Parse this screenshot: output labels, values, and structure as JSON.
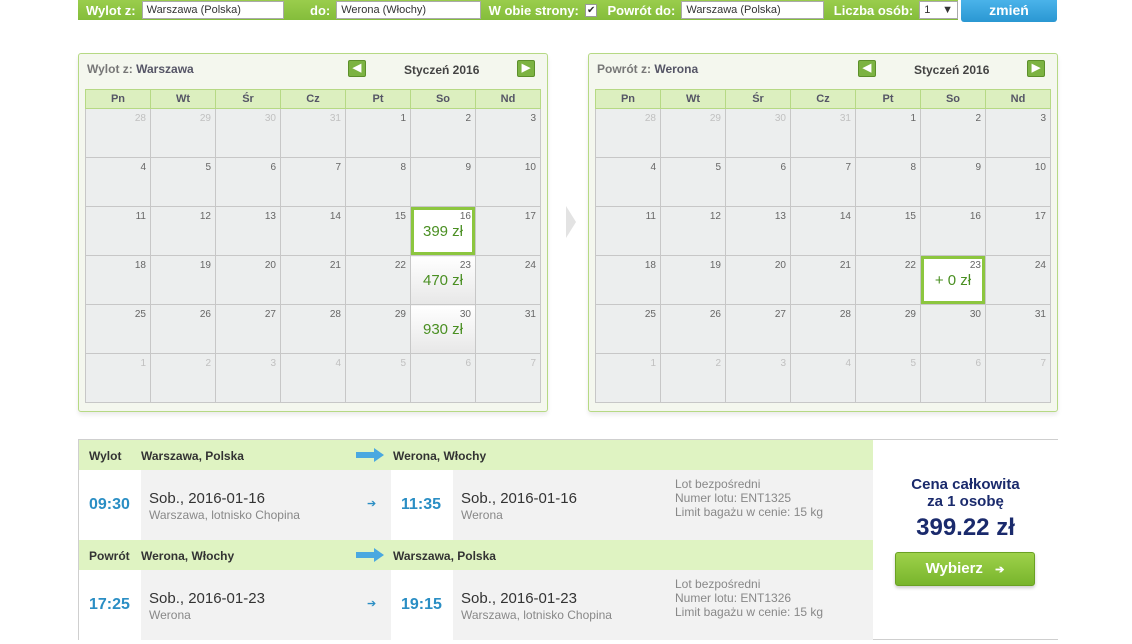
{
  "search": {
    "from_label": "Wylot z:",
    "from_value": "Warszawa (Polska)",
    "to_label": "do:",
    "to_value": "Werona (Włochy)",
    "roundtrip_label": "W obie strony:",
    "roundtrip_checked": "✔",
    "return_label": "Powrót do:",
    "return_value": "Warszawa (Polska)",
    "persons_label": "Liczba osób:",
    "persons_value": "1",
    "submit_label": "zmień"
  },
  "weekdays": [
    "Pn",
    "Wt",
    "Śr",
    "Cz",
    "Pt",
    "So",
    "Nd"
  ],
  "outbound_calendar": {
    "title_prefix": "Wylot z:",
    "title_city": "Warszawa",
    "month": "Styczeń 2016",
    "weeks": [
      [
        {
          "d": "28",
          "o": true
        },
        {
          "d": "29",
          "o": true
        },
        {
          "d": "30",
          "o": true
        },
        {
          "d": "31",
          "o": true
        },
        {
          "d": "1"
        },
        {
          "d": "2"
        },
        {
          "d": "3"
        }
      ],
      [
        {
          "d": "4"
        },
        {
          "d": "5"
        },
        {
          "d": "6"
        },
        {
          "d": "7"
        },
        {
          "d": "8"
        },
        {
          "d": "9"
        },
        {
          "d": "10"
        }
      ],
      [
        {
          "d": "11"
        },
        {
          "d": "12"
        },
        {
          "d": "13"
        },
        {
          "d": "14"
        },
        {
          "d": "15"
        },
        {
          "d": "16",
          "price": "399 zł",
          "selected": true
        },
        {
          "d": "17"
        }
      ],
      [
        {
          "d": "18"
        },
        {
          "d": "19"
        },
        {
          "d": "20"
        },
        {
          "d": "21"
        },
        {
          "d": "22"
        },
        {
          "d": "23",
          "price": "470 zł"
        },
        {
          "d": "24"
        }
      ],
      [
        {
          "d": "25"
        },
        {
          "d": "26"
        },
        {
          "d": "27"
        },
        {
          "d": "28"
        },
        {
          "d": "29"
        },
        {
          "d": "30",
          "price": "930 zł"
        },
        {
          "d": "31"
        }
      ],
      [
        {
          "d": "1",
          "o": true
        },
        {
          "d": "2",
          "o": true
        },
        {
          "d": "3",
          "o": true
        },
        {
          "d": "4",
          "o": true
        },
        {
          "d": "5",
          "o": true
        },
        {
          "d": "6",
          "o": true
        },
        {
          "d": "7",
          "o": true
        }
      ]
    ]
  },
  "return_calendar": {
    "title_prefix": "Powrót z:",
    "title_city": "Werona",
    "month": "Styczeń 2016",
    "weeks": [
      [
        {
          "d": "28",
          "o": true
        },
        {
          "d": "29",
          "o": true
        },
        {
          "d": "30",
          "o": true
        },
        {
          "d": "31",
          "o": true
        },
        {
          "d": "1"
        },
        {
          "d": "2"
        },
        {
          "d": "3"
        }
      ],
      [
        {
          "d": "4"
        },
        {
          "d": "5"
        },
        {
          "d": "6"
        },
        {
          "d": "7"
        },
        {
          "d": "8"
        },
        {
          "d": "9"
        },
        {
          "d": "10"
        }
      ],
      [
        {
          "d": "11"
        },
        {
          "d": "12"
        },
        {
          "d": "13"
        },
        {
          "d": "14"
        },
        {
          "d": "15"
        },
        {
          "d": "16"
        },
        {
          "d": "17"
        }
      ],
      [
        {
          "d": "18"
        },
        {
          "d": "19"
        },
        {
          "d": "20"
        },
        {
          "d": "21"
        },
        {
          "d": "22"
        },
        {
          "d": "23",
          "price": "+ 0 zł",
          "selected": true
        },
        {
          "d": "24"
        }
      ],
      [
        {
          "d": "25"
        },
        {
          "d": "26"
        },
        {
          "d": "27"
        },
        {
          "d": "28"
        },
        {
          "d": "29"
        },
        {
          "d": "30"
        },
        {
          "d": "31"
        }
      ],
      [
        {
          "d": "1",
          "o": true
        },
        {
          "d": "2",
          "o": true
        },
        {
          "d": "3",
          "o": true
        },
        {
          "d": "4",
          "o": true
        },
        {
          "d": "5",
          "o": true
        },
        {
          "d": "6",
          "o": true
        },
        {
          "d": "7",
          "o": true
        }
      ]
    ]
  },
  "outbound": {
    "label": "Wylot",
    "from": "Warszawa, Polska",
    "to": "Werona, Włochy",
    "dep_time": "09:30",
    "dep_date": "Sob., 2016-01-16",
    "dep_place": "Warszawa, lotnisko Chopina",
    "arr_time": "11:35",
    "arr_date": "Sob., 2016-01-16",
    "arr_place": "Werona",
    "info1": "Lot bezpośredni",
    "info2": "Numer lotu: ENT1325",
    "info3": "Limit bagażu w cenie: 15 kg"
  },
  "return": {
    "label": "Powrót",
    "from": "Werona, Włochy",
    "to": "Warszawa, Polska",
    "dep_time": "17:25",
    "dep_date": "Sob., 2016-01-23",
    "dep_place": "Werona",
    "arr_time": "19:15",
    "arr_date": "Sob., 2016-01-23",
    "arr_place": "Warszawa, lotnisko Chopina",
    "info1": "Lot bezpośredni",
    "info2": "Numer lotu: ENT1326",
    "info3": "Limit bagażu w cenie: 15 kg"
  },
  "price": {
    "title_line1": "Cena całkowita",
    "title_line2": "za 1 osobę",
    "amount": "399.22 zł",
    "button": "Wybierz"
  },
  "colors": {
    "accent_green": "#8cc63f",
    "accent_blue": "#2a8ec4",
    "price_navy": "#1a2a6c"
  }
}
